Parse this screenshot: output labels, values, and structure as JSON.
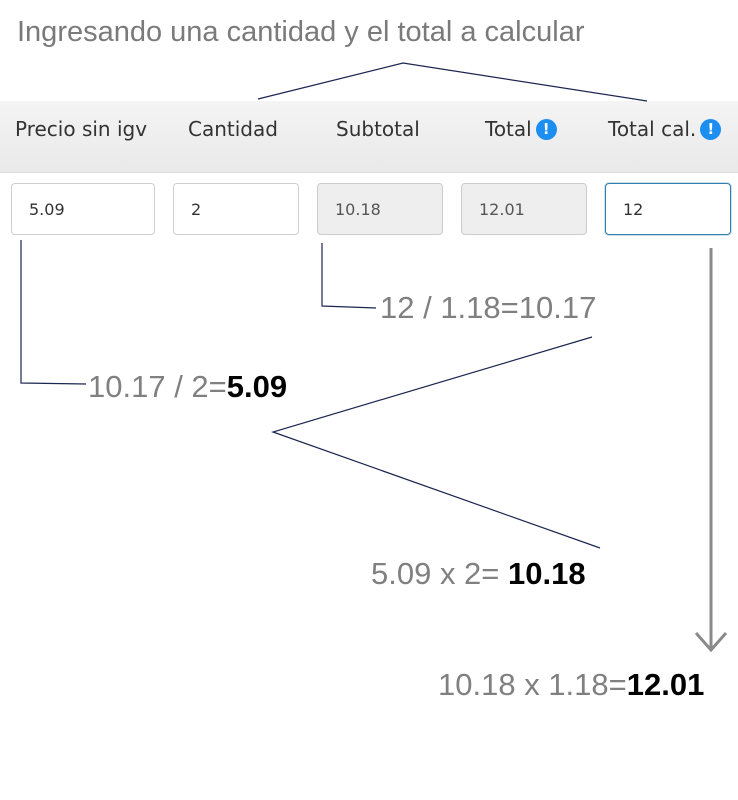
{
  "annotation_title": "Ingresando una cantidad y el total a calcular",
  "table": {
    "headers": {
      "price": "Precio sin igv",
      "qty": "Cantidad",
      "subtotal": "Subtotal",
      "total": "Total",
      "total_calc": "Total cal."
    },
    "info_icon_glyph": "!",
    "values": {
      "price": "5.09",
      "qty": "2",
      "subtotal": "10.18",
      "total": "12.01",
      "total_calc": "12"
    }
  },
  "notes": {
    "step1": {
      "text": "12 / 1.18=10.17"
    },
    "step2": {
      "prefix": "10.17 / 2=",
      "result": "5.09"
    },
    "step3": {
      "prefix": "5.09 x 2= ",
      "result": "10.18"
    },
    "step4": {
      "prefix": "10.18 x 1.18=",
      "result": "12.01"
    }
  },
  "colors": {
    "accent": "#1c8ef0",
    "focus_border": "#2f7fb1",
    "annotation_gray": "#808080",
    "connector_navy": "#1c2650"
  }
}
